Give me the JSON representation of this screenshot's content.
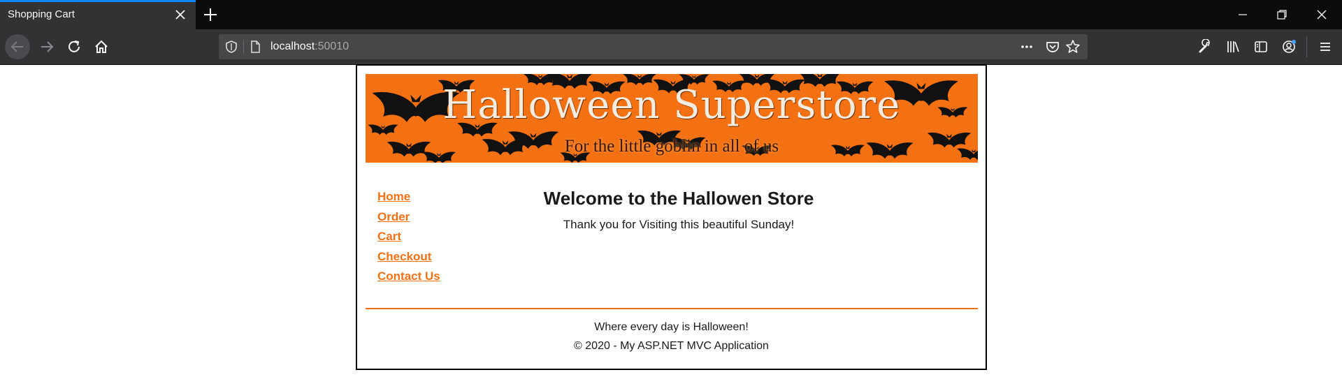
{
  "browser": {
    "tab_title": "Shopping Cart",
    "url_host": "localhost",
    "url_port": ":50010",
    "accent": "#0a84ff"
  },
  "icons": [
    "close-icon",
    "plus-icon",
    "minimize-icon",
    "restore-icon",
    "back-icon",
    "forward-icon",
    "reload-icon",
    "home-icon",
    "shield-icon",
    "page-icon",
    "more-icon",
    "pocket-icon",
    "star-icon",
    "wrench-icon",
    "library-icon",
    "sidebar-icon",
    "account-icon",
    "menu-icon",
    "bat-icon"
  ],
  "banner": {
    "title": "Halloween Superstore",
    "subtitle": "For the little goblin in all of us",
    "background": "#f47113"
  },
  "nav": [
    {
      "label": "Home"
    },
    {
      "label": "Order"
    },
    {
      "label": "Cart"
    },
    {
      "label": "Checkout"
    },
    {
      "label": "Contact Us"
    }
  ],
  "main": {
    "heading": "Welcome to the Hallowen Store",
    "message": "Thank you for Visiting this beautiful Sunday!"
  },
  "footer": {
    "tagline": "Where every day is Halloween!",
    "copyright": "© 2020 - My ASP.NET MVC Application"
  },
  "colors": {
    "link": "#f47113",
    "rule": "#f47113"
  }
}
